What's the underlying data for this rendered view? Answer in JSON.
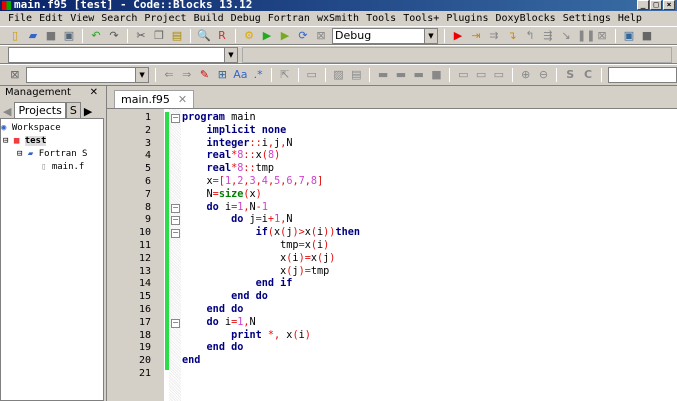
{
  "window": {
    "title": "main.f95 [test] - Code::Blocks 13.12"
  },
  "menu": [
    "File",
    "Edit",
    "View",
    "Search",
    "Project",
    "Build",
    "Debug",
    "Fortran",
    "wxSmith",
    "Tools",
    "Tools+",
    "Plugins",
    "DoxyBlocks",
    "Settings",
    "Help"
  ],
  "toolbar": {
    "build_target": "Debug"
  },
  "management": {
    "title": "Management",
    "tabs": [
      "Projects",
      "S"
    ],
    "tree": [
      "Workspace",
      "test",
      "Fortran S",
      "main.f"
    ]
  },
  "editor": {
    "tab": "main.f95",
    "lines": [
      [
        [
          "k",
          "program"
        ],
        [
          "i",
          " main"
        ]
      ],
      [
        [
          "i",
          "    "
        ],
        [
          "k",
          "implicit none"
        ]
      ],
      [
        [
          "i",
          "    "
        ],
        [
          "k",
          "integer"
        ],
        [
          "o",
          "::"
        ],
        [
          "i",
          "i"
        ],
        [
          "o",
          ","
        ],
        [
          "i",
          "j"
        ],
        [
          "o",
          ","
        ],
        [
          "i",
          "N"
        ]
      ],
      [
        [
          "i",
          "    "
        ],
        [
          "k",
          "real"
        ],
        [
          "o",
          "*"
        ],
        [
          "n",
          "8"
        ],
        [
          "o",
          "::"
        ],
        [
          "i",
          "x"
        ],
        [
          "o",
          "("
        ],
        [
          "n",
          "8"
        ],
        [
          "o",
          ")"
        ]
      ],
      [
        [
          "i",
          "    "
        ],
        [
          "k",
          "real"
        ],
        [
          "o",
          "*"
        ],
        [
          "n",
          "8"
        ],
        [
          "o",
          "::"
        ],
        [
          "i",
          "tmp"
        ]
      ],
      [
        [
          "i",
          "    x"
        ],
        [
          "o",
          "=["
        ],
        [
          "n",
          "1"
        ],
        [
          "o",
          ","
        ],
        [
          "n",
          "2"
        ],
        [
          "o",
          ","
        ],
        [
          "n",
          "3"
        ],
        [
          "o",
          ","
        ],
        [
          "n",
          "4"
        ],
        [
          "o",
          ","
        ],
        [
          "n",
          "5"
        ],
        [
          "o",
          ","
        ],
        [
          "n",
          "6"
        ],
        [
          "o",
          ","
        ],
        [
          "n",
          "7"
        ],
        [
          "o",
          ","
        ],
        [
          "n",
          "8"
        ],
        [
          "o",
          "]"
        ]
      ],
      [
        [
          "i",
          "    N"
        ],
        [
          "o",
          "="
        ],
        [
          "f",
          "size"
        ],
        [
          "o",
          "("
        ],
        [
          "i",
          "x"
        ],
        [
          "o",
          ")"
        ]
      ],
      [
        [
          "i",
          "    "
        ],
        [
          "k",
          "do"
        ],
        [
          "i",
          " i"
        ],
        [
          "o",
          "="
        ],
        [
          "n",
          "1"
        ],
        [
          "o",
          ","
        ],
        [
          "i",
          "N"
        ],
        [
          "o",
          "-"
        ],
        [
          "n",
          "1"
        ]
      ],
      [
        [
          "i",
          "        "
        ],
        [
          "k",
          "do"
        ],
        [
          "i",
          " j"
        ],
        [
          "o",
          "="
        ],
        [
          "i",
          "i"
        ],
        [
          "o",
          "+"
        ],
        [
          "n",
          "1"
        ],
        [
          "o",
          ","
        ],
        [
          "i",
          "N"
        ]
      ],
      [
        [
          "i",
          "            "
        ],
        [
          "k",
          "if"
        ],
        [
          "o",
          "("
        ],
        [
          "i",
          "x"
        ],
        [
          "o",
          "("
        ],
        [
          "i",
          "j"
        ],
        [
          "o",
          ")>"
        ],
        [
          "i",
          "x"
        ],
        [
          "o",
          "("
        ],
        [
          "i",
          "i"
        ],
        [
          "o",
          "))"
        ],
        [
          "k",
          "then"
        ]
      ],
      [
        [
          "i",
          "                tmp"
        ],
        [
          "o",
          "="
        ],
        [
          "i",
          "x"
        ],
        [
          "o",
          "("
        ],
        [
          "i",
          "i"
        ],
        [
          "o",
          ")"
        ]
      ],
      [
        [
          "i",
          "                x"
        ],
        [
          "o",
          "("
        ],
        [
          "i",
          "i"
        ],
        [
          "o",
          ")="
        ],
        [
          "i",
          "x"
        ],
        [
          "o",
          "("
        ],
        [
          "i",
          "j"
        ],
        [
          "o",
          ")"
        ]
      ],
      [
        [
          "i",
          "                x"
        ],
        [
          "o",
          "("
        ],
        [
          "i",
          "j"
        ],
        [
          "o",
          ")="
        ],
        [
          "i",
          "tmp"
        ]
      ],
      [
        [
          "i",
          "            "
        ],
        [
          "k",
          "end if"
        ]
      ],
      [
        [
          "i",
          "        "
        ],
        [
          "k",
          "end do"
        ]
      ],
      [
        [
          "i",
          "    "
        ],
        [
          "k",
          "end do"
        ]
      ],
      [
        [
          "i",
          "    "
        ],
        [
          "k",
          "do"
        ],
        [
          "i",
          " i"
        ],
        [
          "o",
          "="
        ],
        [
          "n",
          "1"
        ],
        [
          "o",
          ","
        ],
        [
          "i",
          "N"
        ]
      ],
      [
        [
          "i",
          "        "
        ],
        [
          "k",
          "print"
        ],
        [
          "o",
          " *, "
        ],
        [
          "i",
          "x"
        ],
        [
          "o",
          "("
        ],
        [
          "i",
          "i"
        ],
        [
          "o",
          ")"
        ]
      ],
      [
        [
          "i",
          "    "
        ],
        [
          "k",
          "end do"
        ]
      ],
      [
        [
          "k",
          "end"
        ]
      ],
      []
    ],
    "fold_lines": [
      1,
      8,
      9,
      10,
      17
    ]
  }
}
